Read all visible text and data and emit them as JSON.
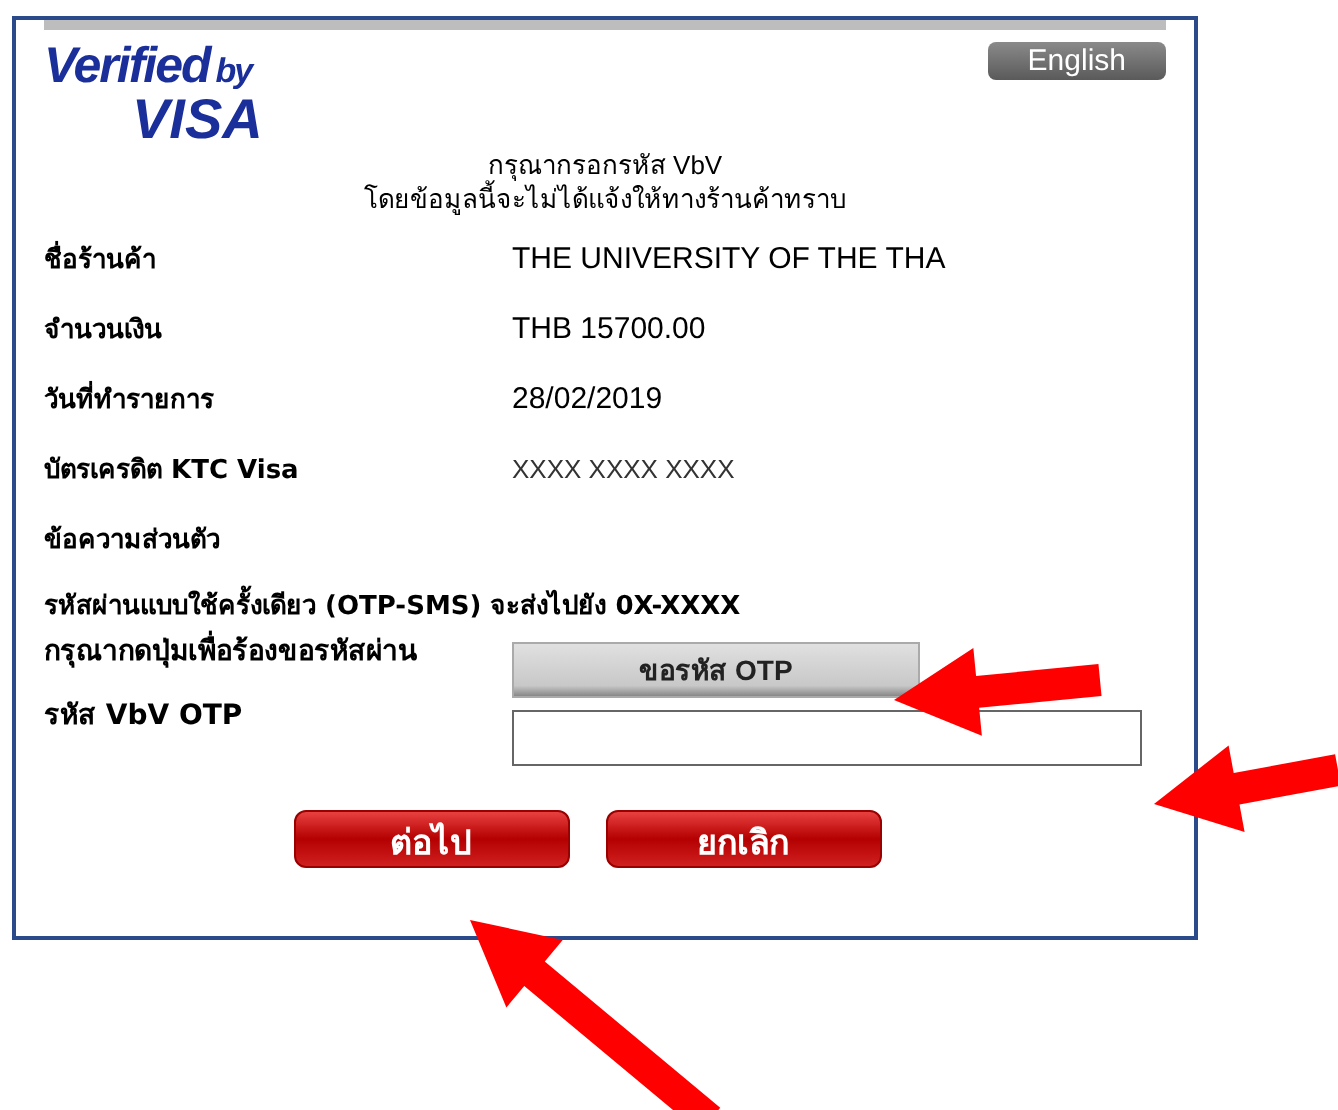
{
  "logo": {
    "word": "Verified",
    "suffix": "by",
    "brand": "VISA"
  },
  "language_button": "English",
  "heading": [
    "กรุณากรอกรหัส VbV",
    "โดยข้อมูลนี้จะไม่ได้แจ้งให้ทางร้านค้าทราบ"
  ],
  "details": [
    {
      "label": "ชื่อร้านค้า",
      "value": "THE UNIVERSITY OF THE THA"
    },
    {
      "label": "จำนวนเงิน",
      "value": "THB 15700.00"
    },
    {
      "label": "วันที่ทำรายการ",
      "value": "28/02/2019"
    },
    {
      "label": "บัตรเครดิต KTC Visa",
      "value": "XXXX XXXX XXXX"
    },
    {
      "label": "ข้อความส่วนตัว"
    }
  ],
  "otp_notice": "รหัสผ่านแบบใช้ครั้งเดียว (OTP-SMS) จะส่งไปยัง 0X-XXXX",
  "request": {
    "label": "กรุณากดปุ่มเพื่อร้องขอรหัสผ่าน",
    "button": "ขอรหัส OTP"
  },
  "otp_field": {
    "label": "รหัส VbV OTP"
  },
  "buttons": [
    "ต่อไป",
    "ยกเลิก"
  ]
}
